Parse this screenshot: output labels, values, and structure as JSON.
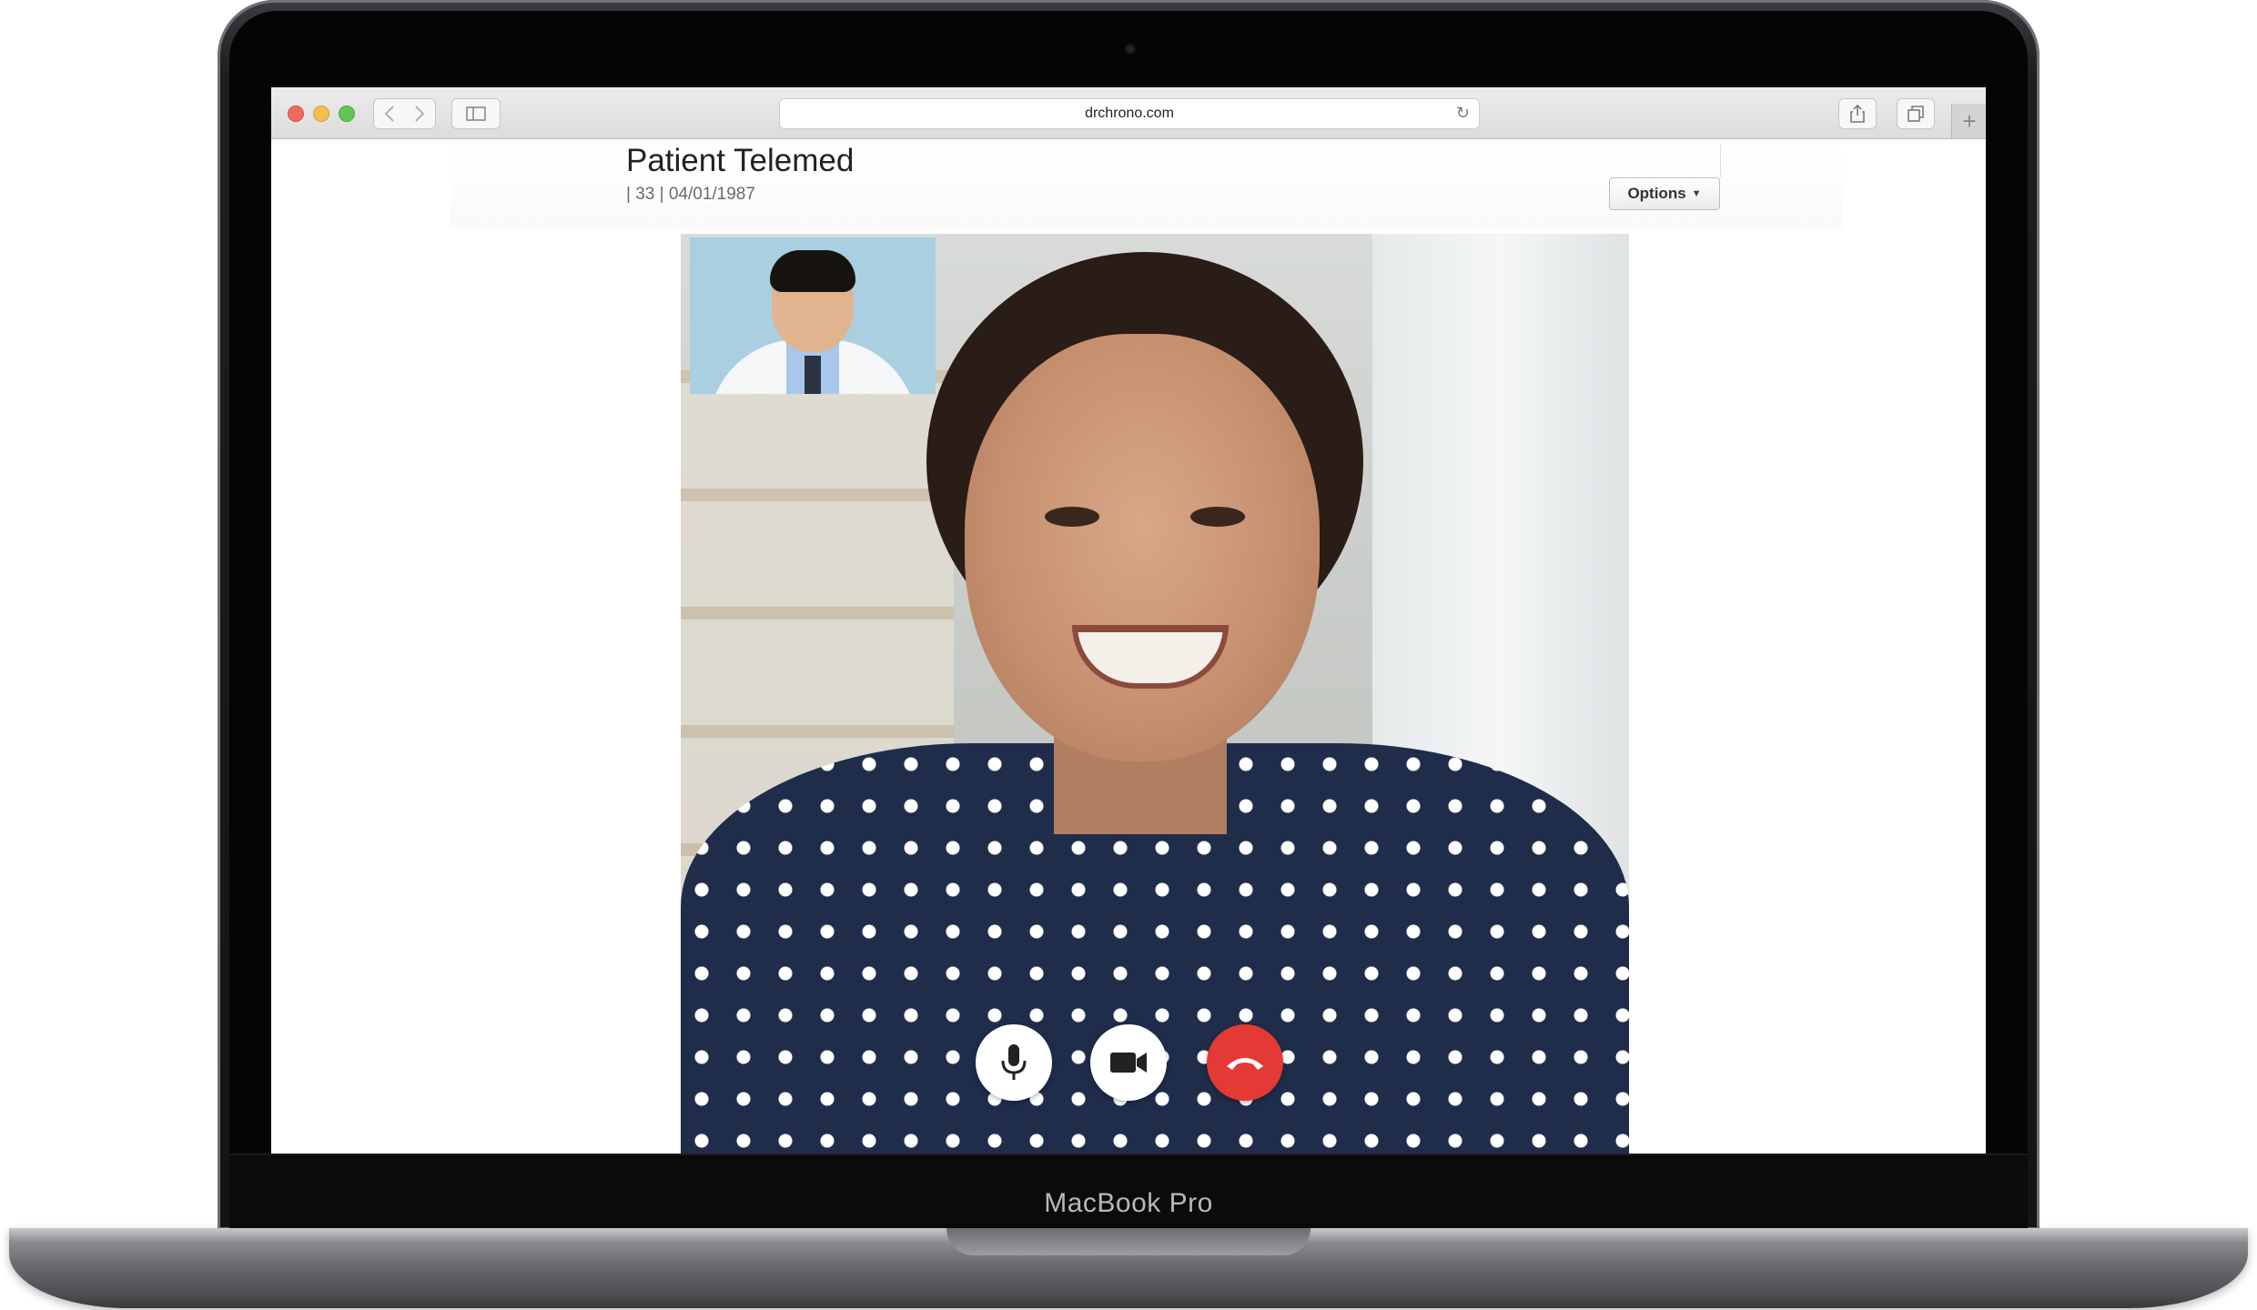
{
  "browser": {
    "url": "drchrono.com"
  },
  "page": {
    "title": "Patient Telemed",
    "subtitle": "| 33 | 04/01/1987",
    "options_label": "Options"
  },
  "device": {
    "label": "MacBook Pro"
  },
  "icons": {
    "back": "chevron-left-icon",
    "forward": "chevron-right-icon",
    "sidebar": "sidebar-icon",
    "reload": "reload-icon",
    "share": "share-icon",
    "tabs": "tabs-icon",
    "new_tab": "plus-icon",
    "mic": "microphone-icon",
    "camera": "video-camera-icon",
    "hangup": "hang-up-icon"
  },
  "colors": {
    "hangup": "#e53935",
    "traffic_close": "#ed6a5e",
    "traffic_minimize": "#f5bf4f",
    "traffic_zoom": "#61c554"
  }
}
